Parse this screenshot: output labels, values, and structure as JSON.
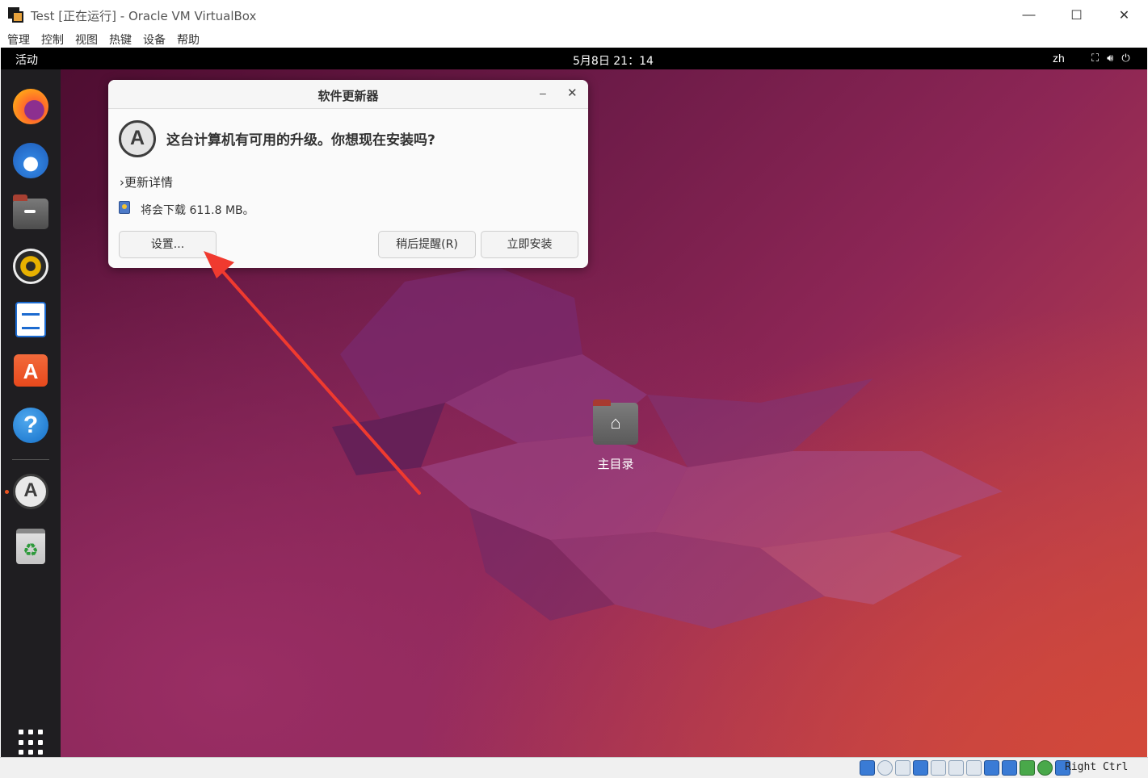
{
  "host": {
    "title": "Test [正在运行] - Oracle VM VirtualBox",
    "menu": [
      "管理",
      "控制",
      "视图",
      "热键",
      "设备",
      "帮助"
    ],
    "window_buttons": {
      "minimize": "—",
      "maximize": "☐",
      "close": "✕"
    }
  },
  "guest": {
    "topbar": {
      "activities": "活动",
      "clock": "5月8日  21：14",
      "lang": "zh",
      "tray": [
        "network-icon",
        "volume-icon",
        "power-icon"
      ]
    },
    "dock": [
      "firefox",
      "thunderbird",
      "files",
      "rhythmbox",
      "libreoffice-writer",
      "ubuntu-software",
      "help",
      "software-updater",
      "trash"
    ],
    "desktop": {
      "home_label": "主目录"
    },
    "dialog": {
      "title": "软件更新器",
      "minimize": "–",
      "close": "✕",
      "question": "这台计算机有可用的升级。你想现在安装吗?",
      "details": "›更新详情",
      "download": "将会下载 611.8 MB。",
      "btn_settings": "设置...",
      "btn_later": "稍后提醒(R)",
      "btn_install": "立即安装"
    }
  },
  "statusbar": {
    "host_key": "Right Ctrl"
  },
  "colors": {
    "ubuntu_orange": "#e95420",
    "arrow_red": "#f03a2f",
    "dock_bg": "#1f1e21"
  }
}
